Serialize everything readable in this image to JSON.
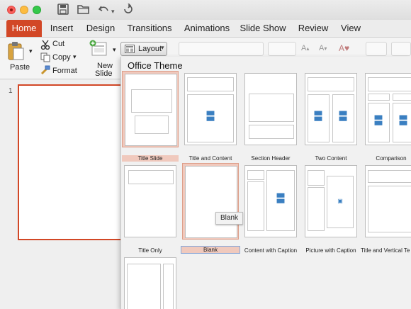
{
  "tabs": [
    "Home",
    "Insert",
    "Design",
    "Transitions",
    "Animations",
    "Slide Show",
    "Review",
    "View"
  ],
  "ribbon": {
    "paste_label": "Paste",
    "cut_label": "Cut",
    "copy_label": "Copy",
    "format_label": "Format",
    "new_slide_label_1": "New",
    "new_slide_label_2": "Slide",
    "layout_label": "Layout"
  },
  "slides": {
    "current_number": "1"
  },
  "gallery": {
    "title": "Office Theme",
    "layouts": [
      "Title Slide",
      "Title and Content",
      "Section Header",
      "Two Content",
      "Comparison",
      "Title Only",
      "Blank",
      "Content with Caption",
      "Picture with Caption",
      "Title and Vertical Te"
    ]
  },
  "tooltip": "Blank",
  "colors": {
    "accent": "#d24726",
    "selection": "#f0c9bd"
  },
  "icons": [
    "close-button",
    "minimize-button",
    "zoom-button",
    "save-icon",
    "open-folder-icon",
    "undo-icon",
    "redo-icon",
    "paste-icon",
    "scissors-icon",
    "copy-icon",
    "format-painter-icon",
    "new-slide-icon",
    "layout-icon"
  ]
}
